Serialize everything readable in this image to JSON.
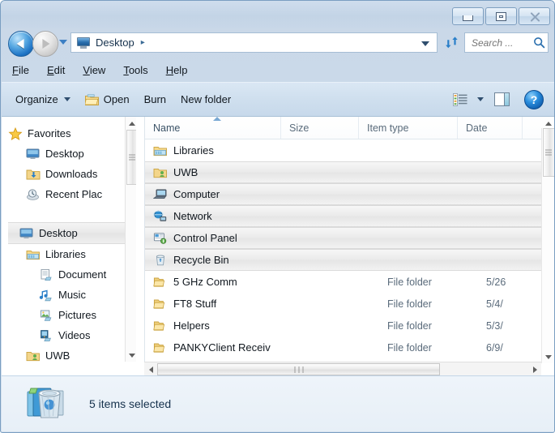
{
  "window": {
    "controls": {
      "minimize": "Minimize",
      "maximize": "Maximize",
      "close": "Close"
    }
  },
  "navigation": {
    "back_label": "Back",
    "forward_label": "Forward",
    "history_label": "Recent pages",
    "refresh_label": "Refresh",
    "address": {
      "icon": "desktop-monitor-icon",
      "crumb": "Desktop",
      "separator": "▸",
      "dropdown_label": "Previous locations"
    },
    "search": {
      "placeholder": "Search ...",
      "value": "",
      "icon": "search-icon"
    }
  },
  "menubar": {
    "items": [
      {
        "accel": "F",
        "rest": "ile"
      },
      {
        "accel": "E",
        "rest": "dit"
      },
      {
        "accel": "V",
        "rest": "iew"
      },
      {
        "accel": "T",
        "rest": "ools"
      },
      {
        "accel": "H",
        "rest": "elp"
      }
    ]
  },
  "toolbar": {
    "organize_label": "Organize",
    "open_label": "Open",
    "burn_label": "Burn",
    "new_folder_label": "New folder",
    "view_label": "Change your view",
    "preview_pane_label": "Show the preview pane",
    "help_label": "?"
  },
  "navpane": {
    "groups": [
      {
        "items": [
          {
            "label": "Favorites",
            "icon": "star-icon",
            "indent": 0,
            "selected": false
          },
          {
            "label": "Desktop",
            "icon": "desktop-monitor-icon",
            "indent": 1,
            "selected": false
          },
          {
            "label": "Downloads",
            "icon": "downloads-folder-icon",
            "indent": 1,
            "selected": false
          },
          {
            "label": "Recent Plac",
            "icon": "recent-places-icon",
            "indent": 1,
            "selected": false
          }
        ]
      },
      {
        "items": [
          {
            "label": "Desktop",
            "icon": "desktop-monitor-icon",
            "indent": 0,
            "selected": true
          },
          {
            "label": "Libraries",
            "icon": "libraries-icon",
            "indent": 1,
            "selected": false
          },
          {
            "label": "Document",
            "icon": "documents-library-icon",
            "indent": 2,
            "selected": false
          },
          {
            "label": "Music",
            "icon": "music-library-icon",
            "indent": 2,
            "selected": false
          },
          {
            "label": "Pictures",
            "icon": "pictures-library-icon",
            "indent": 2,
            "selected": false
          },
          {
            "label": "Videos",
            "icon": "videos-library-icon",
            "indent": 2,
            "selected": false
          },
          {
            "label": "UWB",
            "icon": "user-folder-icon",
            "indent": 1,
            "selected": false
          }
        ]
      }
    ]
  },
  "filelist": {
    "columns": [
      {
        "label": "Name",
        "sorted": "asc"
      },
      {
        "label": "Size",
        "sorted": ""
      },
      {
        "label": "Item type",
        "sorted": ""
      },
      {
        "label": "Date",
        "sorted": ""
      }
    ],
    "rows": [
      {
        "name": "Libraries",
        "size": "",
        "type": "",
        "date": "",
        "icon": "libraries-icon",
        "selected": false
      },
      {
        "name": "UWB",
        "size": "",
        "type": "",
        "date": "",
        "icon": "user-folder-icon",
        "selected": true
      },
      {
        "name": "Computer",
        "size": "",
        "type": "",
        "date": "",
        "icon": "computer-icon",
        "selected": true
      },
      {
        "name": "Network",
        "size": "",
        "type": "",
        "date": "",
        "icon": "network-globe-icon",
        "selected": true
      },
      {
        "name": "Control Panel",
        "size": "",
        "type": "",
        "date": "",
        "icon": "control-panel-icon",
        "selected": true
      },
      {
        "name": "Recycle Bin",
        "size": "",
        "type": "",
        "date": "",
        "icon": "recycle-bin-icon",
        "selected": true
      },
      {
        "name": "5 GHz Comm",
        "size": "",
        "type": "File folder",
        "date": "5/26",
        "icon": "folder-icon",
        "selected": false
      },
      {
        "name": "FT8 Stuff",
        "size": "",
        "type": "File folder",
        "date": "5/4/",
        "icon": "folder-icon",
        "selected": false
      },
      {
        "name": "Helpers",
        "size": "",
        "type": "File folder",
        "date": "5/3/",
        "icon": "folder-icon",
        "selected": false
      },
      {
        "name": "PANKYClient Receiv",
        "size": "",
        "type": "File folder",
        "date": "6/9/",
        "icon": "folder-icon",
        "selected": false
      }
    ]
  },
  "statusbar": {
    "icon": "selected-items-stack-icon",
    "text": "5 items selected"
  },
  "colors": {
    "chrome": "#c8d7e8",
    "accent_blue": "#1d72c4",
    "selection": "#e9e9e9",
    "text": "#11181f",
    "muted_text": "#5a6b7b"
  }
}
